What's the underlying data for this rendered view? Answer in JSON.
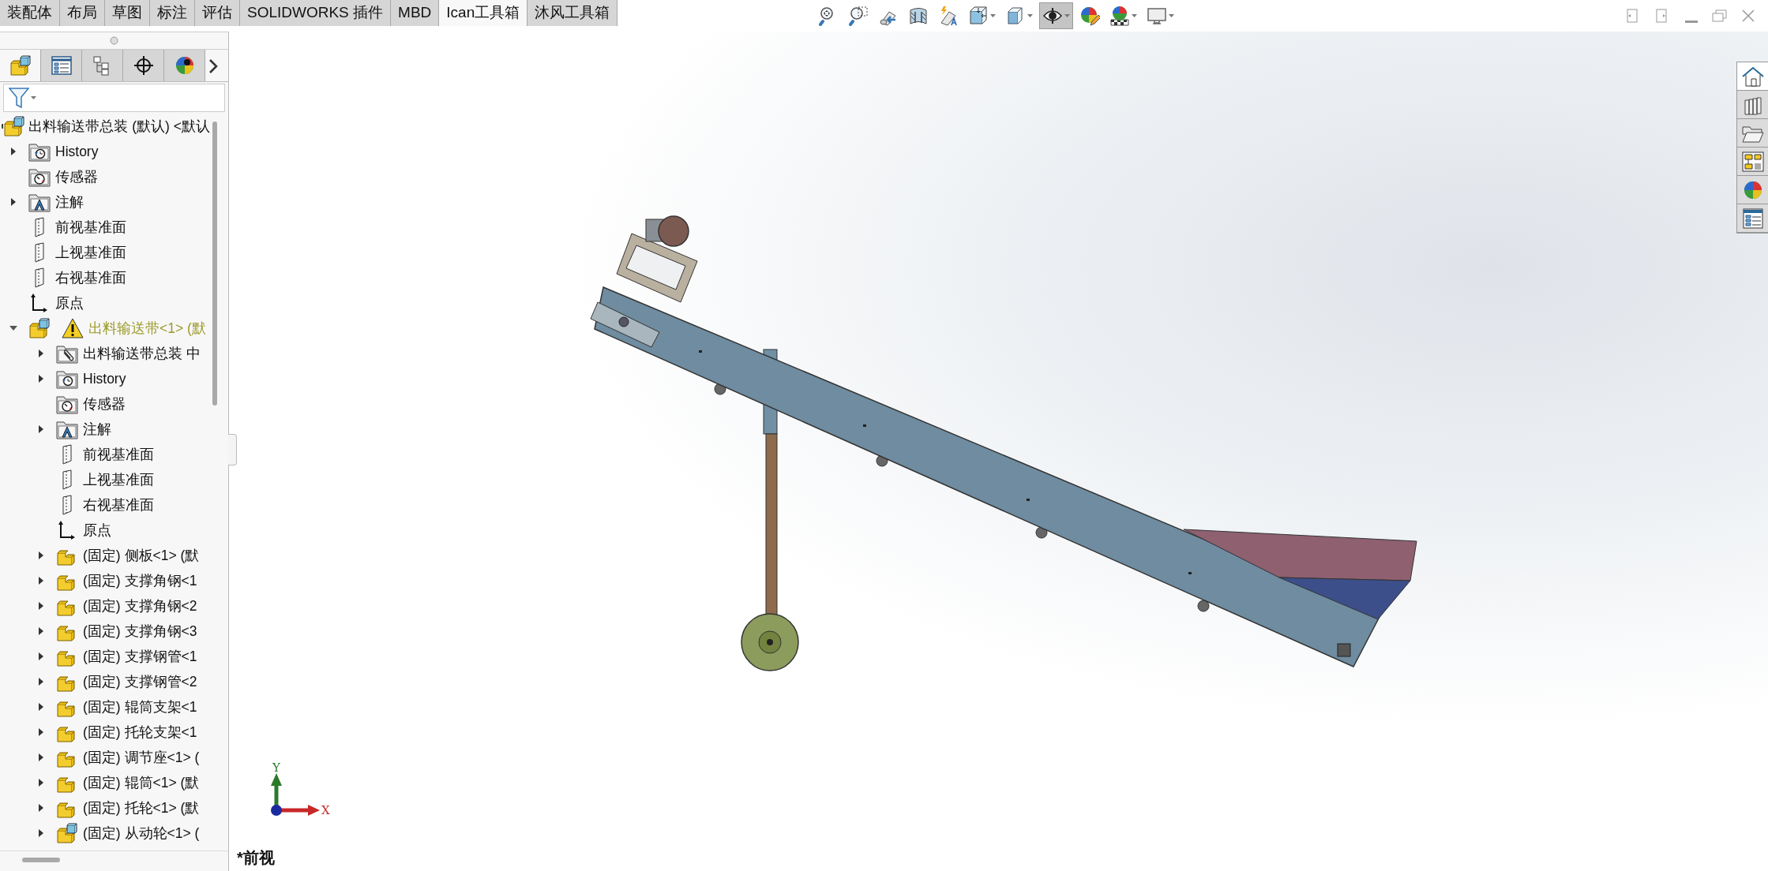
{
  "ribbon_tabs": [
    {
      "label": "装配体",
      "selected": false
    },
    {
      "label": "布局",
      "selected": false
    },
    {
      "label": "草图",
      "selected": false
    },
    {
      "label": "标注",
      "selected": false
    },
    {
      "label": "评估",
      "selected": false
    },
    {
      "label": "SOLIDWORKS 插件",
      "selected": false
    },
    {
      "label": "MBD",
      "selected": false
    },
    {
      "label": "Ican工具箱",
      "selected": true
    },
    {
      "label": "沐风工具箱",
      "selected": false
    }
  ],
  "view_toolbar": [
    {
      "selected": false,
      "dropdown": false
    },
    {
      "selected": false,
      "dropdown": false
    },
    {
      "selected": false,
      "dropdown": false
    },
    {
      "selected": false,
      "dropdown": false
    },
    {
      "selected": false,
      "dropdown": false
    },
    {
      "selected": false,
      "dropdown": true
    },
    {
      "selected": false,
      "dropdown": true
    },
    {
      "selected": true,
      "dropdown": true
    },
    {
      "selected": false,
      "dropdown": false
    },
    {
      "selected": false,
      "dropdown": true
    },
    {
      "selected": false,
      "dropdown": true
    }
  ],
  "panel_tabs": [
    {
      "selected": true
    },
    {
      "selected": false
    },
    {
      "selected": false
    },
    {
      "selected": false
    },
    {
      "selected": false
    }
  ],
  "tree": {
    "label": "出料输送带总装 (默认) <默认",
    "children": [
      {
        "label": "History",
        "kind": "history",
        "expanded": false,
        "warning": false
      },
      {
        "label": "传感器",
        "kind": "sensors",
        "warning": false
      },
      {
        "label": "注解",
        "kind": "annotations",
        "expanded": false,
        "warning": false
      },
      {
        "label": "前视基准面",
        "kind": "plane",
        "warning": false
      },
      {
        "label": "上视基准面",
        "kind": "plane",
        "warning": false
      },
      {
        "label": "右视基准面",
        "kind": "plane",
        "warning": false
      },
      {
        "label": "原点",
        "kind": "origin",
        "warning": false
      },
      {
        "label": "出料输送带<1> (默",
        "kind": "assembly",
        "expanded": true,
        "warning": true,
        "children": [
          {
            "label": "出料输送带总装 中",
            "kind": "references",
            "expanded": false,
            "warning": false
          },
          {
            "label": "History",
            "kind": "history",
            "expanded": false,
            "warning": false
          },
          {
            "label": "传感器",
            "kind": "sensors",
            "warning": false
          },
          {
            "label": "注解",
            "kind": "annotations",
            "expanded": false,
            "warning": false
          },
          {
            "label": "前视基准面",
            "kind": "plane",
            "warning": false
          },
          {
            "label": "上视基准面",
            "kind": "plane",
            "warning": false
          },
          {
            "label": "右视基准面",
            "kind": "plane",
            "warning": false
          },
          {
            "label": "原点",
            "kind": "origin",
            "warning": false
          },
          {
            "label": "(固定) 侧板<1> (默",
            "kind": "part",
            "expanded": false,
            "warning": false
          },
          {
            "label": "(固定) 支撑角钢<1",
            "kind": "part",
            "expanded": false,
            "warning": false
          },
          {
            "label": "(固定) 支撑角钢<2",
            "kind": "part",
            "expanded": false,
            "warning": false
          },
          {
            "label": "(固定) 支撑角钢<3",
            "kind": "part",
            "expanded": false,
            "warning": false
          },
          {
            "label": "(固定) 支撑钢管<1",
            "kind": "part",
            "expanded": false,
            "warning": false
          },
          {
            "label": "(固定) 支撑钢管<2",
            "kind": "part",
            "expanded": false,
            "warning": false
          },
          {
            "label": "(固定) 辊筒支架<1",
            "kind": "part",
            "expanded": false,
            "warning": false
          },
          {
            "label": "(固定) 托轮支架<1",
            "kind": "part",
            "expanded": false,
            "warning": false
          },
          {
            "label": "(固定) 调节座<1> (",
            "kind": "part",
            "expanded": false,
            "warning": false
          },
          {
            "label": "(固定) 辊筒<1> (默",
            "kind": "part",
            "expanded": false,
            "warning": false
          },
          {
            "label": "(固定) 托轮<1> (默",
            "kind": "part",
            "expanded": false,
            "warning": false
          },
          {
            "label": "(固定) 从动轮<1> (",
            "kind": "assembly",
            "expanded": false,
            "warning": false
          }
        ]
      }
    ]
  },
  "triad": {
    "y_label": "Y",
    "x_label": "X"
  },
  "view_label": "*前视",
  "task_pane": [
    {
      "selected": true
    },
    {
      "selected": false
    },
    {
      "selected": false
    },
    {
      "selected": false
    },
    {
      "selected": false
    },
    {
      "selected": false
    }
  ]
}
